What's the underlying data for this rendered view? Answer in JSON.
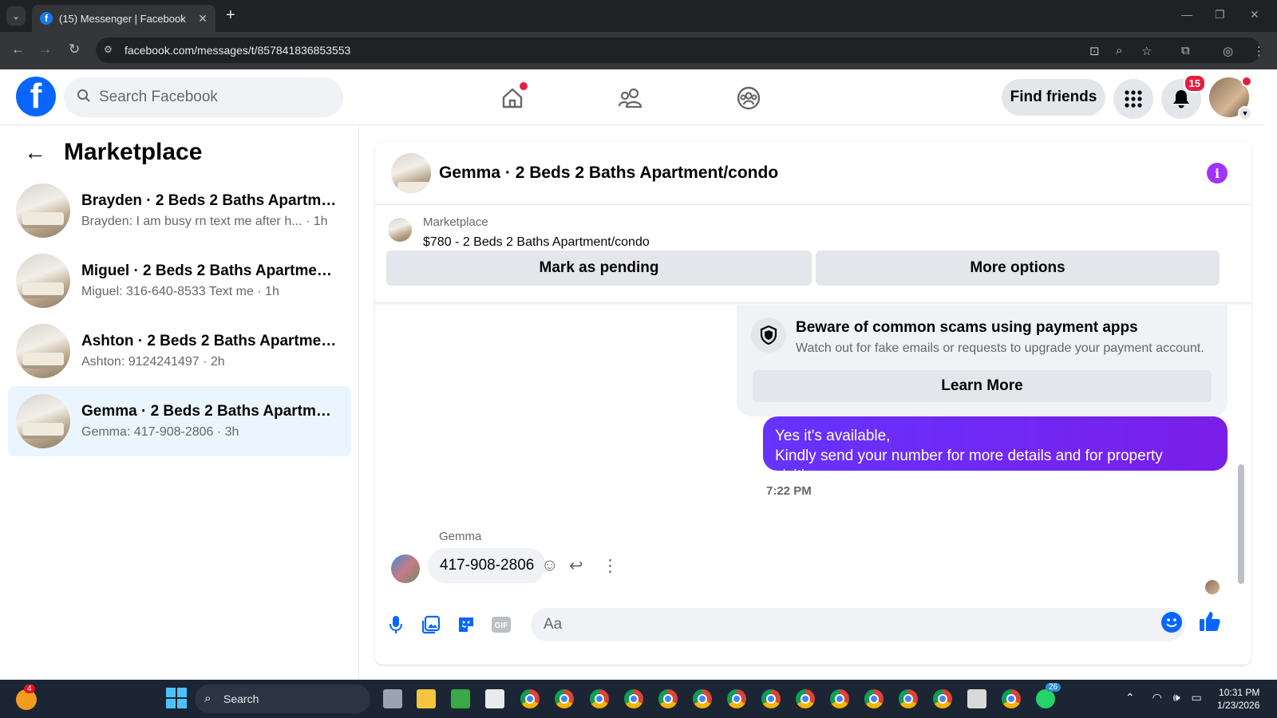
{
  "browser": {
    "tab_title": "(15) Messenger | Facebook",
    "url": "facebook.com/messages/t/857841836853553"
  },
  "header": {
    "search_placeholder": "Search Facebook",
    "find_friends": "Find friends",
    "notification_count": "15"
  },
  "sidebar": {
    "title": "Marketplace",
    "conversations": [
      {
        "name": "Brayden · 2 Beds 2 Baths Apartme...",
        "preview": "Brayden: I am busy rn text me after h...  · 1h",
        "active": false
      },
      {
        "name": "Miguel · 2 Beds 2 Baths Apartmen...",
        "preview": "Miguel: 316-640-8533 Text me · 1h",
        "active": false
      },
      {
        "name": "Ashton · 2 Beds 2 Baths Apartmen...",
        "preview": "Ashton: 9124241497 · 2h",
        "active": false
      },
      {
        "name": "Gemma · 2 Beds 2 Baths Apartme...",
        "preview": "Gemma: 417-908-2806 · 3h",
        "active": true
      }
    ]
  },
  "chat": {
    "title": "Gemma · 2 Beds 2 Baths Apartment/condo",
    "marketplace_label": "Marketplace",
    "listing": "$780 - 2 Beds 2 Baths Apartment/condo",
    "mark_pending": "Mark as pending",
    "more_options": "More options",
    "scam_title": "Beware of common scams using payment apps",
    "scam_subtitle": "Watch out for fake emails or requests to upgrade your payment account.",
    "learn_more": "Learn More",
    "sent_line1": "Yes it's available,",
    "sent_line2": "Kindly send your number for more details and for property visiting.",
    "timestamp": "7:22 PM",
    "sender_name": "Gemma",
    "received": "417-908-2806",
    "composer_placeholder": "Aa"
  },
  "taskbar": {
    "search": "Search",
    "weather_badge": "4",
    "whatsapp_badge": "26",
    "time": "10:31 PM",
    "date": "1/23/2026"
  },
  "colors": {
    "fb_blue": "#0866ff",
    "sent_bubble": "#6e1ef7",
    "active_row": "#ebf5ff",
    "badge_red": "#e41e3f"
  }
}
